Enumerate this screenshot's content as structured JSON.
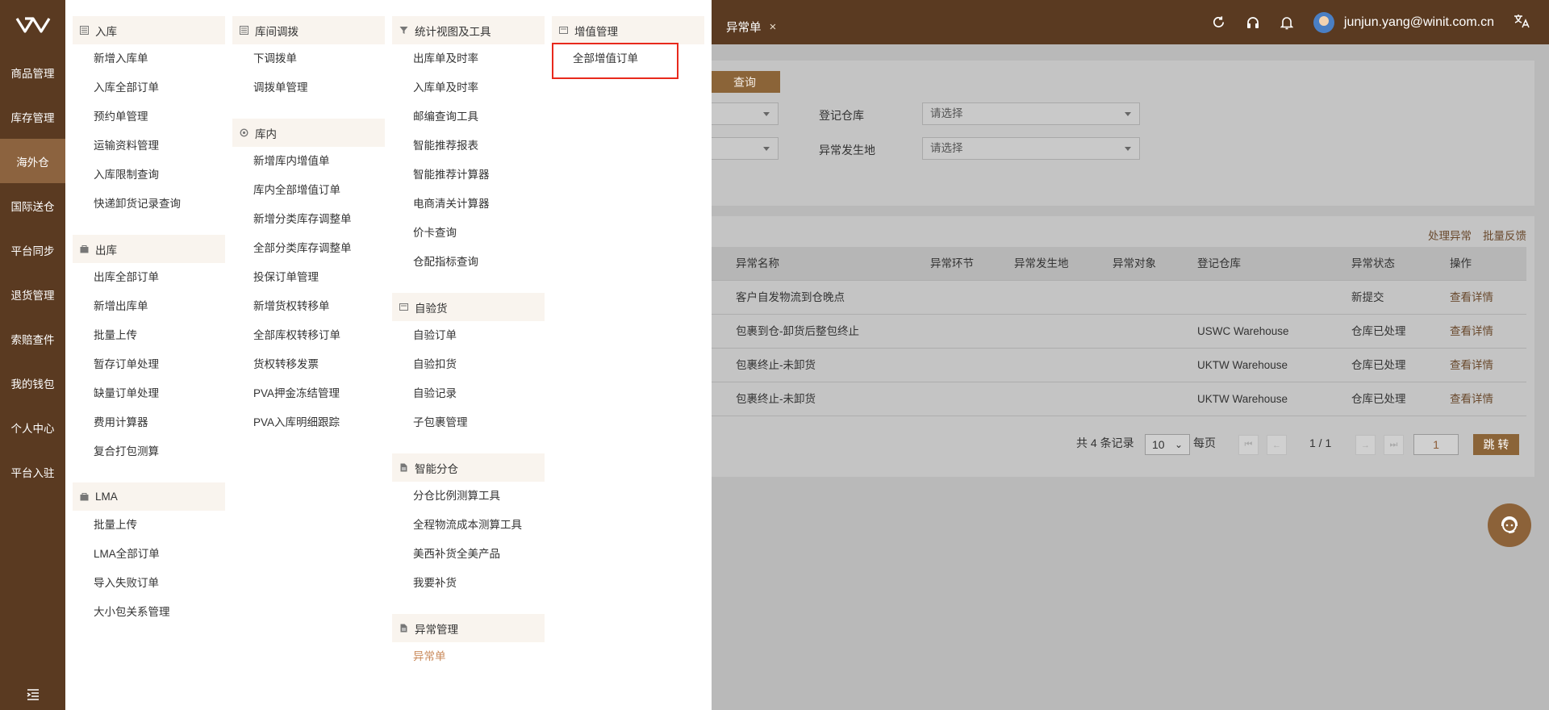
{
  "sidenav": {
    "items": [
      "商品管理",
      "库存管理",
      "海外仓",
      "国际送仓",
      "平台同步",
      "退货管理",
      "索赔查件",
      "我的钱包",
      "个人中心",
      "平台入驻"
    ]
  },
  "menu": {
    "col1": {
      "g1": {
        "title": "入库",
        "items": [
          "新增入库单",
          "入库全部订单",
          "预约单管理",
          "运输资料管理",
          "入库限制查询",
          "快递卸货记录查询"
        ]
      },
      "g2": {
        "title": "出库",
        "items": [
          "出库全部订单",
          "新增出库单",
          "批量上传",
          "暂存订单处理",
          "缺量订单处理",
          "费用计算器",
          "复合打包测算"
        ]
      },
      "g3": {
        "title": "LMA",
        "items": [
          "批量上传",
          "LMA全部订单",
          "导入失败订单",
          "大小包关系管理"
        ]
      }
    },
    "col2": {
      "g1": {
        "title": "库间调拨",
        "items": [
          "下调拨单",
          "调拨单管理"
        ]
      },
      "g2": {
        "title": "库内",
        "items": [
          "新增库内增值单",
          "库内全部增值订单",
          "新增分类库存调整单",
          "全部分类库存调整单",
          "投保订单管理",
          "新增货权转移单",
          "全部库权转移订单",
          "货权转移发票",
          "PVA押金冻结管理",
          "PVA入库明细跟踪"
        ]
      }
    },
    "col3": {
      "g1": {
        "title": "统计视图及工具",
        "items": [
          "出库单及时率",
          "入库单及时率",
          "邮编查询工具",
          "智能推荐报表",
          "智能推荐计算器",
          "电商清关计算器",
          "价卡查询",
          "仓配指标查询"
        ]
      },
      "g2": {
        "title": "自验货",
        "items": [
          "自验订单",
          "自验扣货",
          "自验记录",
          "子包裹管理"
        ]
      },
      "g3": {
        "title": "智能分仓",
        "items": [
          "分仓比例测算工具",
          "全程物流成本测算工具",
          "美西补货全美产品",
          "我要补货"
        ]
      },
      "g4": {
        "title": "异常管理",
        "items": [
          "异常单"
        ]
      }
    },
    "col4": {
      "g1": {
        "title": "增值管理",
        "items": [
          "全部增值订单"
        ]
      }
    }
  },
  "header": {
    "tab_label": "异常单",
    "tab_close": "×",
    "user": "junjun.yang@winit.com.cn"
  },
  "filters": {
    "query_button": "查询",
    "label1": "登记仓库",
    "label2": "异常发生地",
    "placeholder": "请选择"
  },
  "actions": {
    "handle": "处理异常",
    "batch": "批量反馈"
  },
  "table": {
    "columns": [
      "异常名称",
      "异常环节",
      "异常发生地",
      "异常对象",
      "登记仓库",
      "异常状态",
      "操作"
    ],
    "rows": [
      {
        "name": "客户自发物流到仓晚点",
        "warehouse": "",
        "status": "新提交",
        "op": "查看详情"
      },
      {
        "name": "包裹到仓-卸货后整包终止",
        "warehouse": "USWC Warehouse",
        "status": "仓库已处理",
        "op": "查看详情"
      },
      {
        "name": "包裹终止-未卸货",
        "warehouse": "UKTW Warehouse",
        "status": "仓库已处理",
        "op": "查看详情"
      },
      {
        "name": "包裹终止-未卸货",
        "warehouse": "UKTW Warehouse",
        "status": "仓库已处理",
        "op": "查看详情"
      }
    ]
  },
  "pager": {
    "total": "共 4 条记录",
    "page_size": "10",
    "per_page": "每页",
    "page_info": "1 / 1",
    "page_input": "1",
    "jump": "跳 转"
  },
  "icons": {
    "logo": "winit-logo-icon",
    "refresh": "refresh-icon",
    "headset": "headset-icon",
    "bell": "bell-icon",
    "translate": "translate-icon",
    "collapse": "menu-collapse-icon",
    "support": "customer-service-icon"
  },
  "colors": {
    "brand": "#5a3a21",
    "accent": "#8b6438",
    "active_link": "#c9895a",
    "highlight_box": "#e8291c"
  }
}
